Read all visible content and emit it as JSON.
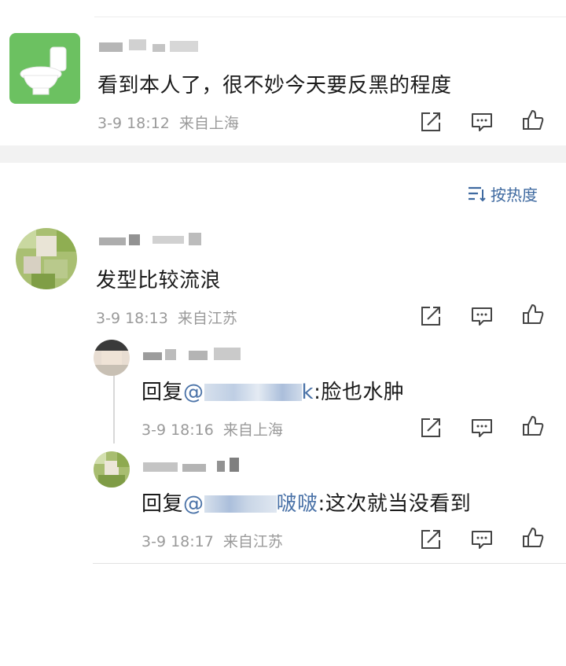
{
  "comments": [
    {
      "username": "",
      "text": "看到本人了，很不妙今天要反黑的程度",
      "date": "3-9 18:12",
      "location": "来自上海",
      "avatar": "toilet-icon"
    },
    {
      "username": "",
      "text": "发型比较流浪",
      "date": "3-9 18:13",
      "location": "来自江苏",
      "avatar": "blurred-avatar"
    }
  ],
  "replies": [
    {
      "username": "",
      "prefix": "回复",
      "mention": "@",
      "mention_visible": "k",
      "text": ":脸也水肿",
      "date": "3-9 18:16",
      "location": "来自上海"
    },
    {
      "username": "",
      "prefix": "回复",
      "mention": "@",
      "mention_visible": "啵啵",
      "text": ":这次就当没看到",
      "date": "3-9 18:17",
      "location": "来自江苏"
    }
  ],
  "sort_label": "按热度",
  "colors": {
    "link": "#4b73a8",
    "meta": "#9a9a9a",
    "separator": "#f2f2f2"
  },
  "icons": [
    "share-icon",
    "comment-icon",
    "like-icon",
    "sort-icon"
  ]
}
